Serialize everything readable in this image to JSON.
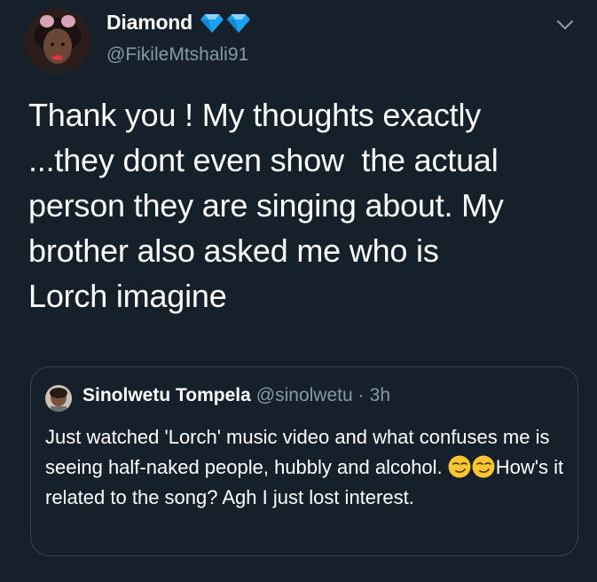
{
  "author": {
    "display_name": "Diamond",
    "badges": [
      "diamond-icon",
      "diamond-icon"
    ],
    "handle": "@FikileMtshali91"
  },
  "tweet": {
    "text_line1": "Thank you ! My thoughts exactly",
    "text_line2": "...they dont even show  the actual",
    "text_line3": "person they are singing about. My",
    "text_line4": "brother also asked me who is",
    "text_line5": "Lorch imagine"
  },
  "quoted": {
    "display_name": "Sinolwetu Tompela",
    "handle": "@sinolwetu",
    "separator": "·",
    "time": "3h",
    "text_before": "Just watched 'Lorch' music video and what confuses me is seeing half-naked people, hubbly and alcohol. ",
    "emojis": [
      "smirking-face-icon",
      "smirking-face-icon"
    ],
    "text_after": "How's it related to the song? Agh I just lost interest."
  },
  "colors": {
    "background": "#15202b",
    "secondary_text": "#8899a6",
    "border": "#38444d",
    "diamond": "#1da1f2"
  }
}
